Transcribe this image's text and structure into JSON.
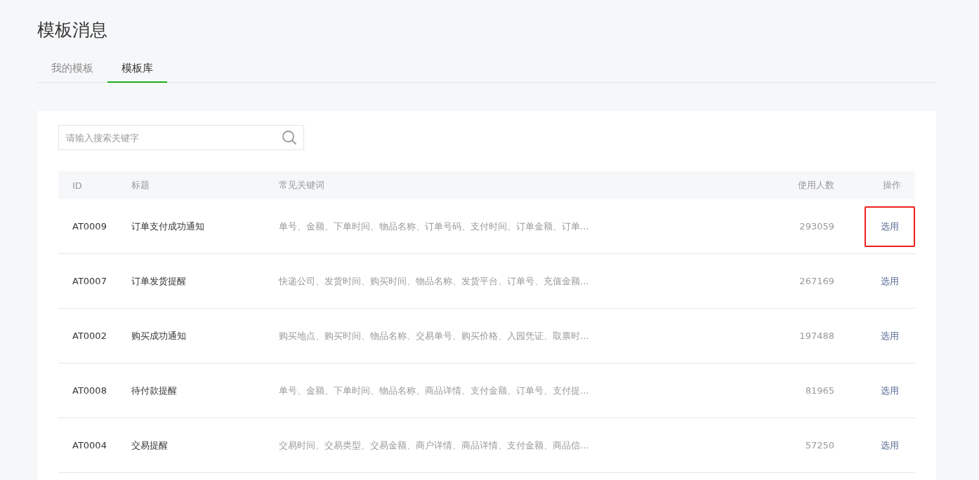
{
  "page_title": "模板消息",
  "tabs": [
    {
      "label": "我的模板",
      "selected": false
    },
    {
      "label": "模板库",
      "selected": true
    }
  ],
  "search": {
    "placeholder": "请输入搜索关键字"
  },
  "table": {
    "columns": [
      "ID",
      "标题",
      "常见关键词",
      "使用人数",
      "操作"
    ],
    "rows": [
      {
        "id": "AT0009",
        "title": "订单支付成功通知",
        "keywords": "单号、金额、下单时间、物品名称、订单号码、支付时间、订单金额、订单...",
        "users": "293059",
        "action": "选用",
        "highlighted": true
      },
      {
        "id": "AT0007",
        "title": "订单发货提醒",
        "keywords": "快递公司、发货时间、购买时间、物品名称、发货平台、订单号、充值金额...",
        "users": "267169",
        "action": "选用",
        "highlighted": false
      },
      {
        "id": "AT0002",
        "title": "购买成功通知",
        "keywords": "购买地点、购买时间、物品名称、交易单号、购买价格、入园凭证、取票时...",
        "users": "197488",
        "action": "选用",
        "highlighted": false
      },
      {
        "id": "AT0008",
        "title": "待付款提醒",
        "keywords": "单号、金额、下单时间、物品名称、商品详情、支付金额、订单号、支付提...",
        "users": "81965",
        "action": "选用",
        "highlighted": false
      },
      {
        "id": "AT0004",
        "title": "交易提醒",
        "keywords": "交易时间、交易类型、交易金额、商户详情、商品详情、支付金额、商品信...",
        "users": "57250",
        "action": "选用",
        "highlighted": false
      }
    ]
  }
}
